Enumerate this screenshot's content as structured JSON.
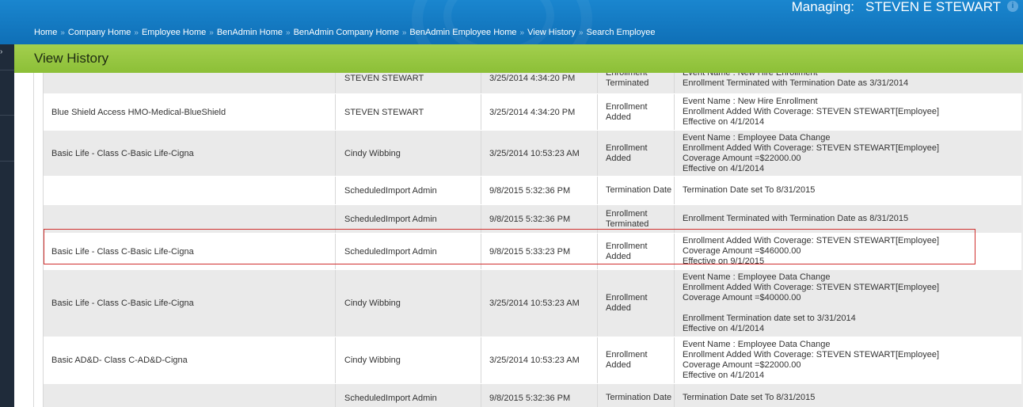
{
  "header": {
    "managing_label": "Managing:",
    "managing_name": "STEVEN E STEWART",
    "info_icon": "info-icon"
  },
  "breadcrumb": [
    "Home",
    "Company Home",
    "Employee Home",
    "BenAdmin Home",
    "BenAdmin Company Home",
    "BenAdmin Employee Home",
    "View History",
    "Search Employee"
  ],
  "breadcrumb_separator": "»",
  "page_title": "View History",
  "colors": {
    "header_blue": "#1584cc",
    "title_green": "#96c641",
    "row_alt": "#eaeaea",
    "highlight_red": "#d0302f"
  },
  "rows": [
    {
      "plan": "",
      "user": "STEVEN STEWART",
      "date": "3/25/2014 4:34:20 PM",
      "action": [
        "Enrollment",
        "Terminated"
      ],
      "details": [
        "Event Name : New Hire Enrollment",
        "Enrollment Terminated with Termination Date as 3/31/2014"
      ]
    },
    {
      "plan": "Blue Shield Access HMO-Medical-BlueShield",
      "user": "STEVEN STEWART",
      "date": "3/25/2014 4:34:20 PM",
      "action": [
        "Enrollment",
        "Added"
      ],
      "details": [
        "Event Name : New Hire Enrollment",
        "Enrollment Added With Coverage: STEVEN STEWART[Employee]",
        "Effective on 4/1/2014"
      ]
    },
    {
      "plan": "Basic Life - Class C-Basic Life-Cigna",
      "user": "Cindy Wibbing",
      "date": "3/25/2014 10:53:23 AM",
      "action": [
        "Enrollment",
        "Added"
      ],
      "details": [
        "Event Name : Employee Data Change",
        "Enrollment Added With Coverage: STEVEN STEWART[Employee]",
        "Coverage Amount =$22000.00",
        "Effective on 4/1/2014"
      ]
    },
    {
      "plan": "",
      "user": "ScheduledImport Admin",
      "date": "9/8/2015 5:32:36 PM",
      "action": [
        "Termination Date"
      ],
      "details": [
        "Termination Date set To 8/31/2015"
      ]
    },
    {
      "plan": "",
      "user": "ScheduledImport Admin",
      "date": "9/8/2015 5:32:36 PM",
      "action": [
        "Enrollment",
        "Terminated"
      ],
      "details": [
        "Enrollment Terminated with Termination Date as 8/31/2015"
      ]
    },
    {
      "plan": "Basic Life - Class C-Basic Life-Cigna",
      "user": "ScheduledImport Admin",
      "date": "9/8/2015 5:33:23 PM",
      "action": [
        "Enrollment",
        "Added"
      ],
      "details": [
        "Enrollment Added With Coverage: STEVEN STEWART[Employee]",
        "Coverage Amount =$46000.00",
        "Effective on 9/1/2015"
      ]
    },
    {
      "plan": "Basic Life - Class C-Basic Life-Cigna",
      "user": "Cindy Wibbing",
      "date": "3/25/2014 10:53:23 AM",
      "action": [
        "Enrollment",
        "Added"
      ],
      "details": [
        "Event Name : Employee Data Change",
        "Enrollment Added With Coverage: STEVEN STEWART[Employee]",
        "Coverage Amount =$40000.00",
        "",
        "Enrollment Termination date set to 3/31/2014",
        "Effective on 4/1/2014"
      ]
    },
    {
      "plan": "Basic AD&D- Class C-AD&D-Cigna",
      "user": "Cindy Wibbing",
      "date": "3/25/2014 10:53:23 AM",
      "action": [
        "Enrollment",
        "Added"
      ],
      "details": [
        "Event Name : Employee Data Change",
        "Enrollment Added With Coverage: STEVEN STEWART[Employee]",
        "Coverage Amount =$22000.00",
        "Effective on 4/1/2014"
      ]
    },
    {
      "plan": "",
      "user": "ScheduledImport Admin",
      "date": "9/8/2015 5:32:36 PM",
      "action": [
        "Termination Date"
      ],
      "details": [
        "Termination Date set To 8/31/2015"
      ]
    }
  ]
}
